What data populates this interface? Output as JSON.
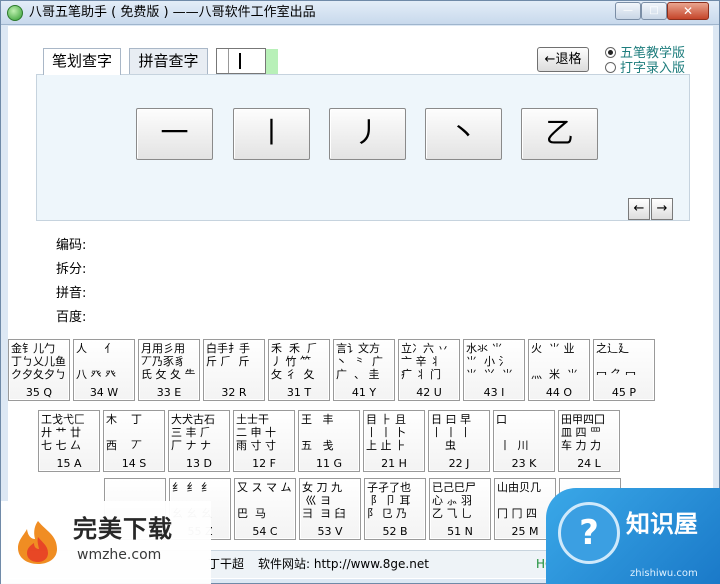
{
  "window": {
    "title": "八哥五笔助手 ( 免费版 ) ——八哥软件工作室出品",
    "min_label": "—",
    "max_label": "□",
    "close_label": "✕"
  },
  "tabs": [
    {
      "label": "笔划查字",
      "active": true
    },
    {
      "label": "拼音查字",
      "active": false
    }
  ],
  "toolbar": {
    "back_label": "←退格",
    "radio_wubi": "五笔教学版",
    "radio_typing": "打字录入版"
  },
  "strokes": [
    "一",
    "丨",
    "丿",
    "丶",
    "乙"
  ],
  "nav": {
    "prev": "←",
    "next": "→"
  },
  "info_labels": {
    "code": "编码:",
    "split": "拆分:",
    "pinyin": "拼音:",
    "baidu": "百度:"
  },
  "keyboard": {
    "row1": [
      {
        "roots": "金钅儿勹\n丁ㄅ乂儿鱼\nク夕夂夕ㄅ",
        "code": "35 Q"
      },
      {
        "roots": "人     亻\n\n八 癶 癶",
        "code": "34 W"
      },
      {
        "roots": "月用彡用\n丆乃豕豸\n氏 ⺙ 夂 ⺧",
        "code": "33 E"
      },
      {
        "roots": "白手扌手\n斤 ⺁  斤",
        "code": "32 R"
      },
      {
        "roots": "禾  禾  ⺁\n丿 竹 ⺮\n攵 彳  夂",
        "code": "31 T"
      },
      {
        "roots": "言讠文方\n丶  ⺀  广\n广  、 圭",
        "code": "41 Y"
      },
      {
        "roots": "立冫六 丷\n亠 辛 丬\n疒 ⺦ 门",
        "code": "42 U"
      },
      {
        "roots": "水氺 ⺌\n⺌  小 氵\n⺌  ⺍  ⺌",
        "code": "43 I"
      },
      {
        "roots": "火  ⺌ 业\n\n灬  米  ⺌",
        "code": "44 O"
      },
      {
        "roots": "之辶廴\n\n冖 ⺈ 冖",
        "code": "45 P"
      }
    ],
    "row2": [
      {
        "roots": "工戈弋匚\n廾 艹 廿\n七 七 厶",
        "code": "15 A"
      },
      {
        "roots": "木    丁\n\n西    丆",
        "code": "14 S"
      },
      {
        "roots": "大犬古石\n三 丰 ⺁\n厂 ナ ナ",
        "code": "13 D"
      },
      {
        "roots": "土士干\n二 申 十\n雨 寸 寸",
        "code": "12 F"
      },
      {
        "roots": "王   丰\n\n五   戋",
        "code": "11 G"
      },
      {
        "roots": "目 ⺊ 且\n丨 丨 卜\n上 止 ⺊",
        "code": "21 H"
      },
      {
        "roots": "日 曰 早\n丨 丨 丨\n    虫",
        "code": "22 J"
      },
      {
        "roots": "口\n\n 丨  川",
        "code": "23 K"
      },
      {
        "roots": "田甲四囗\n皿 四 罒\n车 力 力",
        "code": "24 L"
      }
    ],
    "row3": [
      {
        "roots": "",
        "code": ""
      },
      {
        "roots": "纟 纟 纟\n\n幺 幺 幺",
        "code": "55 Z"
      },
      {
        "roots": "又 ス マ ム\n\n巴  马",
        "code": "54 C"
      },
      {
        "roots": "女 刀 九\n 巛 ヨ\n彐  ヨ 臼",
        "code": "53 V"
      },
      {
        "roots": "子孑了也\n 阝 卩 耳\n阝 ⺋ 乃",
        "code": "52 B"
      },
      {
        "roots": "已己巳尸\n心 ⺗ 羽\n乙 ⺄ 乚",
        "code": "51 N"
      },
      {
        "roots": "山由贝几\n\n冂 冂 四",
        "code": "25 M"
      },
      {
        "roots": "<",
        "code": ""
      }
    ]
  },
  "footer": {
    "author": "丁干超",
    "site_label": "软件网站: http://www.8ge.net",
    "right_text": "HO"
  },
  "watermarks": {
    "left_title": "完美下载",
    "left_sub": "wmzhe.com",
    "right_icon": "?",
    "right_title": "知识屋",
    "right_sub": "zhishiwu.com"
  }
}
